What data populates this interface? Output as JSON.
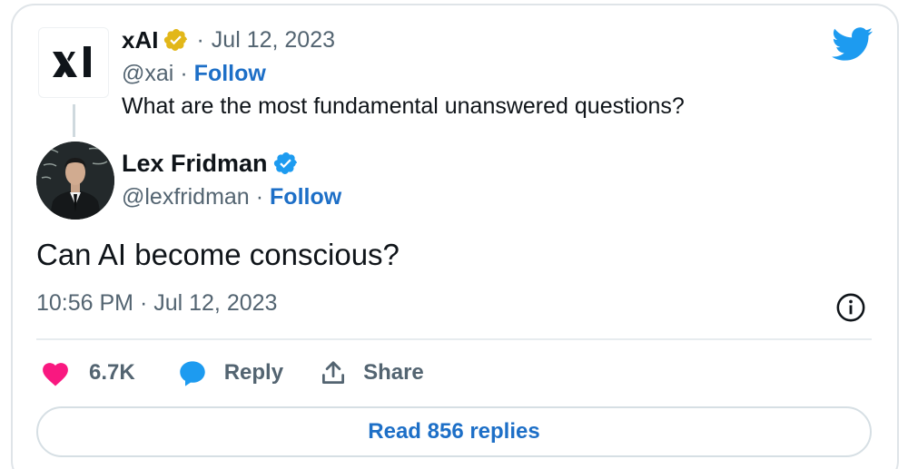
{
  "quoted": {
    "name": "xAI",
    "separator": "·",
    "date": "Jul 12, 2023",
    "handle": "@xai",
    "handle_separator": "·",
    "follow_label": "Follow",
    "text": "What are the most fundamental unanswered questions?",
    "logo_text": "xI"
  },
  "tweet": {
    "name": "Lex Fridman",
    "handle": "@lexfridman",
    "handle_separator": "·",
    "follow_label": "Follow",
    "text": "Can AI become conscious?",
    "timestamp": "10:56 PM · Jul 12, 2023"
  },
  "actions": {
    "likes": "6.7K",
    "reply_label": "Reply",
    "share_label": "Share"
  },
  "footer": {
    "read_replies_label": "Read 856 replies"
  },
  "colors": {
    "brand": "#1d9bf0",
    "link": "#1d6fc7",
    "like": "#f91880",
    "gold_badge": "#e2b719",
    "muted": "#536471"
  },
  "icons": {
    "platform": "twitter-bird-icon",
    "verified_org": "gold-verified-badge-icon",
    "verified_user": "blue-verified-badge-icon",
    "info": "info-circle-icon",
    "like": "heart-icon",
    "reply": "speech-bubble-icon",
    "share": "share-upload-icon"
  }
}
